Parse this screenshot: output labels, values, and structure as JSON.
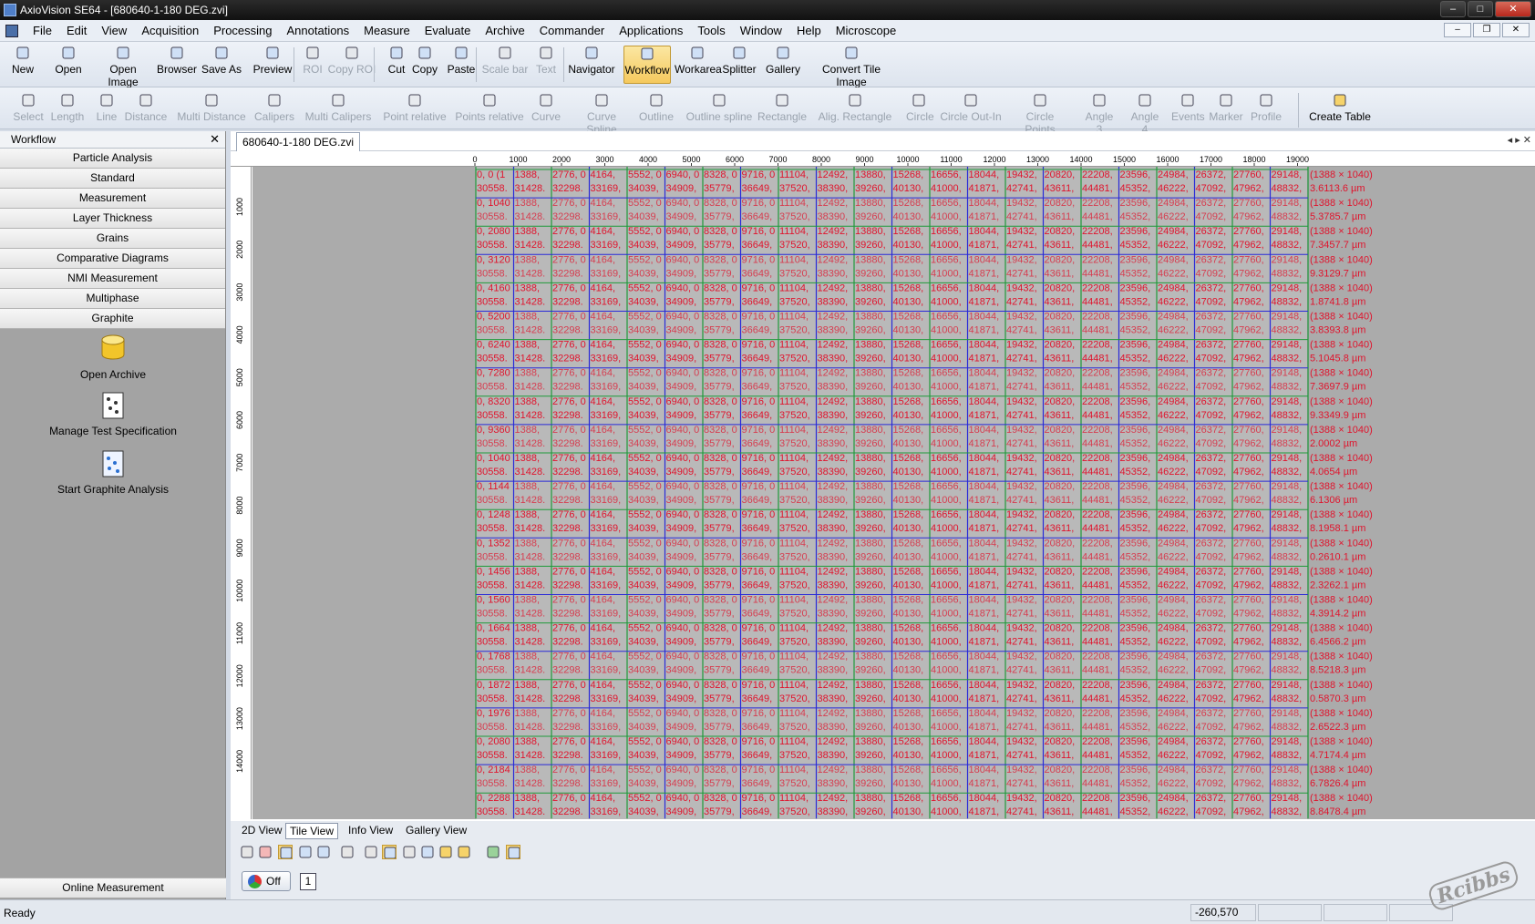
{
  "window": {
    "title": "AxioVision SE64 - [680640-1-180 DEG.zvi]",
    "controls": [
      "–",
      "□",
      "✕"
    ]
  },
  "menu": [
    "File",
    "Edit",
    "View",
    "Acquisition",
    "Processing",
    "Annotations",
    "Measure",
    "Evaluate",
    "Archive",
    "Commander",
    "Applications",
    "Tools",
    "Window",
    "Help",
    "Microscope"
  ],
  "mdi_controls": [
    "–",
    "❐",
    "✕"
  ],
  "toolbar_main": [
    {
      "label": "New",
      "icon": "new-icon",
      "state": "enabled"
    },
    {
      "label": "Open",
      "icon": "open-icon",
      "state": "enabled"
    },
    {
      "label": "Open Image",
      "icon": "open-image-icon",
      "state": "enabled"
    },
    {
      "label": "Browser",
      "icon": "browser-icon",
      "state": "enabled"
    },
    {
      "label": "Save As",
      "icon": "save-as-icon",
      "state": "enabled"
    },
    {
      "label": "Preview",
      "icon": "preview-icon",
      "state": "enabled"
    },
    {
      "label": "ROI",
      "icon": "roi-icon",
      "state": "disabled"
    },
    {
      "label": "Copy ROI",
      "icon": "copy-roi-icon",
      "state": "disabled"
    },
    {
      "label": "Cut",
      "icon": "cut-icon",
      "state": "enabled"
    },
    {
      "label": "Copy",
      "icon": "copy-icon",
      "state": "enabled"
    },
    {
      "label": "Paste",
      "icon": "paste-icon",
      "state": "enabled"
    },
    {
      "label": "Scale bar",
      "icon": "scale-bar-icon",
      "state": "disabled"
    },
    {
      "label": "Text",
      "icon": "text-icon",
      "state": "disabled"
    },
    {
      "label": "Navigator",
      "icon": "navigator-icon",
      "state": "enabled"
    },
    {
      "label": "Workflow",
      "icon": "workflow-icon",
      "state": "active"
    },
    {
      "label": "Workarea",
      "icon": "workarea-icon",
      "state": "enabled"
    },
    {
      "label": "Splitter",
      "icon": "splitter-icon",
      "state": "enabled"
    },
    {
      "label": "Gallery",
      "icon": "gallery-icon",
      "state": "enabled"
    },
    {
      "label": "Convert Tile Image",
      "icon": "convert-tile-icon",
      "state": "enabled"
    }
  ],
  "toolbar_measure": [
    {
      "label": "Select",
      "icon": "select-icon"
    },
    {
      "label": "Length",
      "icon": "length-icon"
    },
    {
      "label": "Line",
      "icon": "line-icon"
    },
    {
      "label": "Distance",
      "icon": "distance-icon"
    },
    {
      "label": "Multi Distance",
      "icon": "multi-distance-icon"
    },
    {
      "label": "Calipers",
      "icon": "calipers-icon"
    },
    {
      "label": "Multi Calipers",
      "icon": "multi-calipers-icon"
    },
    {
      "label": "Point relative",
      "icon": "point-relative-icon"
    },
    {
      "label": "Points relative",
      "icon": "points-relative-icon"
    },
    {
      "label": "Curve",
      "icon": "curve-icon"
    },
    {
      "label": "Curve Spline",
      "icon": "curve-spline-icon"
    },
    {
      "label": "Outline",
      "icon": "outline-icon"
    },
    {
      "label": "Outline spline",
      "icon": "outline-spline-icon"
    },
    {
      "label": "Rectangle",
      "icon": "rectangle-icon"
    },
    {
      "label": "Alig. Rectangle",
      "icon": "aligned-rectangle-icon"
    },
    {
      "label": "Circle",
      "icon": "circle-icon"
    },
    {
      "label": "Circle Out-In",
      "icon": "circle-out-in-icon"
    },
    {
      "label": "Circle Points",
      "icon": "circle-points-icon"
    },
    {
      "label": "Angle 3",
      "icon": "angle3-icon"
    },
    {
      "label": "Angle 4",
      "icon": "angle4-icon"
    },
    {
      "label": "Events",
      "icon": "events-icon"
    },
    {
      "label": "Marker",
      "icon": "marker-icon"
    },
    {
      "label": "Profile",
      "icon": "profile-icon"
    },
    {
      "label": "Create Table",
      "icon": "create-table-icon"
    }
  ],
  "workflow": {
    "title": "Workflow",
    "close": "✕",
    "categories": [
      "Particle Analysis",
      "Standard",
      "Measurement",
      "Layer Thickness",
      "Grains",
      "Comparative Diagrams",
      "NMI Measurement",
      "Multiphase",
      "Graphite"
    ],
    "tasks": [
      {
        "label": "Open Archive",
        "icon": "archive-database-icon"
      },
      {
        "label": "Manage Test Specification",
        "icon": "test-specification-icon"
      },
      {
        "label": "Start Graphite Analysis",
        "icon": "graphite-analysis-icon"
      }
    ],
    "bottom_label": "Online Measurement"
  },
  "document": {
    "tab": "680640-1-180 DEG.zvi",
    "nav": "◂ ▸ ✕",
    "ruler_x_labels": [
      "0",
      "1000",
      "2000",
      "3000",
      "4000",
      "5000",
      "6000",
      "7000",
      "8000",
      "9000",
      "10000",
      "11000",
      "12000",
      "13000",
      "14000",
      "15000",
      "16000",
      "17000",
      "18000",
      "19000"
    ],
    "ruler_y_labels": [
      "1000",
      "2000",
      "3000",
      "4000",
      "5000",
      "6000",
      "7000",
      "8000",
      "9000",
      "10000",
      "11000",
      "12000",
      "13000",
      "14000"
    ],
    "tile_x_labels": [
      "0, 0 (1",
      "1388,",
      "2776, 0",
      "4164,",
      "5552, 0",
      "6940, 0",
      "8328, 0",
      "9716, 0",
      "11104,",
      "12492,",
      "13880,",
      "15268,",
      "16656,",
      "18044,",
      "19432,",
      "20820,",
      "22208,",
      "23596,",
      "24984,",
      "26372,",
      "27760,",
      "29148,"
    ],
    "tile_bottom_labels": [
      "30558.",
      "31428.",
      "32298.",
      "33169,",
      "34039,",
      "34909,",
      "35779,",
      "36649,",
      "37520,",
      "38390,",
      "39260,",
      "40130,",
      "41000,",
      "41871,",
      "42741,",
      "43611,",
      "44481,",
      "45352,",
      "46222,",
      "47092,",
      "47962,",
      "48832,"
    ],
    "tile_row_starts": [
      "0, 0 (1",
      "0, 1040",
      "0, 2080",
      "0, 3120",
      "0, 4160",
      "0, 5200",
      "0, 6240",
      "0, 7280",
      "0, 8320",
      "0, 9360",
      "0, 1040",
      "0, 1144",
      "0, 1248",
      "0, 1352",
      "0, 1456",
      "0, 1560",
      "0, 1664",
      "0, 1768",
      "0, 1872",
      "0, 1976",
      "0, 2080",
      "0, 2184",
      "0, 2288"
    ],
    "tile_row_ends_a": [
      "(1388 × 1040)",
      "(1388 × 1040)",
      "(1388 × 1040)",
      "(1388 × 1040)",
      "(1388 × 1040)",
      "(1388 × 1040)",
      "(1388 × 1040)",
      "(1388 × 1040)",
      "(1388 × 1040)",
      "(1388 × 1040)",
      "(1388 × 1040)",
      "(1388 × 1040)",
      "(1388 × 1040)",
      "(1388 × 1040)",
      "(1388 × 1040)",
      "(1388 × 1040)",
      "(1388 × 1040)",
      "(1388 × 1040)",
      "(1388 × 1040)",
      "(1388 × 1040)",
      "(1388 × 1040)",
      "(1388 × 1040)",
      "(1388 × 1040)"
    ],
    "tile_row_ends_b": [
      "3.6113.6 µm",
      "5.3785.7 µm",
      "7.3457.7 µm",
      "9.3129.7 µm",
      "1.8741.8 µm",
      "3.8393.8 µm",
      "5.1045.8 µm",
      "7.3697.9 µm",
      "9.3349.9 µm",
      "2.0002 µm",
      "4.0654 µm",
      "6.1306 µm",
      "8.1958.1 µm",
      "0.2610.1 µm",
      "2.3262.1 µm",
      "4.3914.2 µm",
      "6.4566.2 µm",
      "8.5218.3 µm",
      "0.5870.3 µm",
      "2.6522.3 µm",
      "4.7174.4 µm",
      "6.7826.4 µm",
      "8.8478.4 µm"
    ],
    "view_tabs": [
      "2D View",
      "Tile View",
      "Info View",
      "Gallery View"
    ],
    "active_view": "Tile View",
    "view_tool_icons": [
      "pan-icon",
      "delete-marker-icon",
      "zoom-fit-icon",
      "zoom-in-icon",
      "zoom-out-icon",
      "select-rect-icon",
      "stage-icon",
      "focus-icon",
      "overlay-icon",
      "grid-icon",
      "export-icon",
      "pen-icon",
      "copy-green-icon",
      "undo-icon"
    ],
    "toggle_label": "Off",
    "page_number": "1"
  },
  "status": {
    "ready": "Ready",
    "coordinates": "-260,570"
  },
  "watermark": "Rcibbs",
  "colors": {
    "titlebar": "#1a1a1a",
    "annotation_red": "#e0142d",
    "tile_green": "#1f9a3a",
    "tile_blue": "#2a2ad8",
    "viewport_gray": "#ababab"
  }
}
